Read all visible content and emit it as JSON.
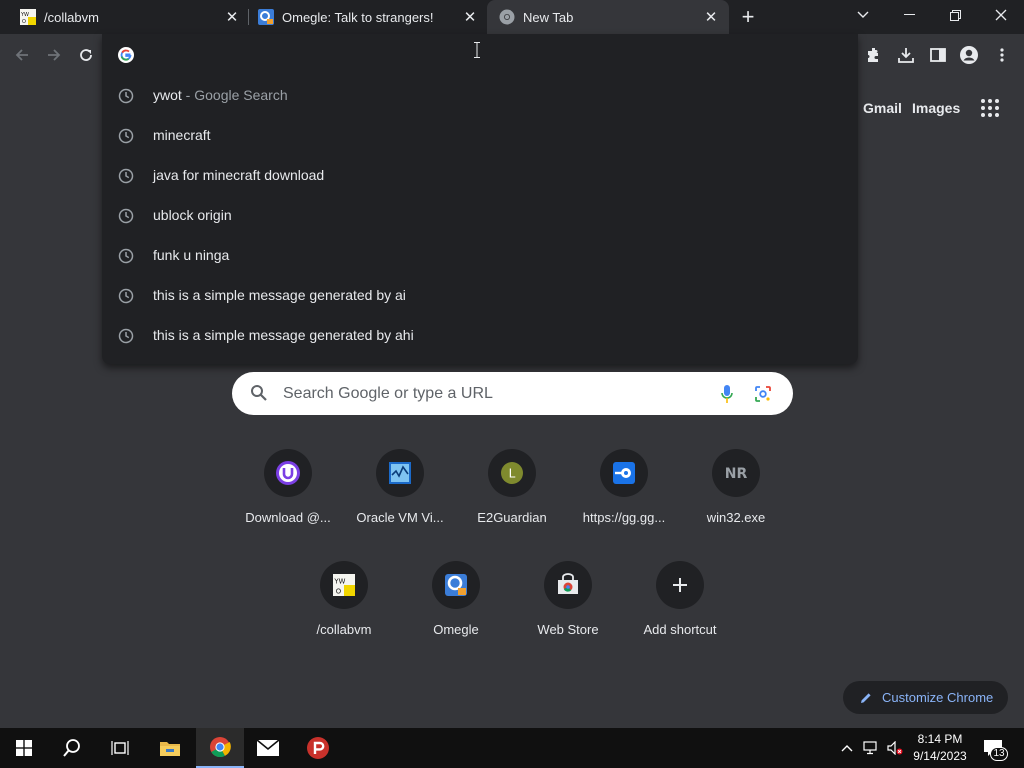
{
  "tabs": [
    {
      "title": "/collabvm",
      "favicon": "ywot-icon"
    },
    {
      "title": "Omegle: Talk to strangers!",
      "favicon": "omegle-icon"
    },
    {
      "title": "New Tab",
      "favicon": "chrome-icon",
      "active": true
    }
  ],
  "omnibox": {
    "value": "",
    "suggestions": [
      {
        "text": "ywot",
        "desc": " - Google Search"
      },
      {
        "text": "minecraft",
        "desc": ""
      },
      {
        "text": "java for minecraft download",
        "desc": ""
      },
      {
        "text": "ublock origin",
        "desc": ""
      },
      {
        "text": "funk u ninga",
        "desc": ""
      },
      {
        "text": "this is a simple message generated by ai",
        "desc": ""
      },
      {
        "text": "this is a simple message generated by ahi",
        "desc": ""
      }
    ]
  },
  "header_links": {
    "gmail": "Gmail",
    "images": "Images"
  },
  "search": {
    "placeholder": "Search Google or type a URL"
  },
  "shortcuts": [
    {
      "label": "Download @...",
      "icon": "U"
    },
    {
      "label": "Oracle VM Vi...",
      "icon": "virtualbox-icon"
    },
    {
      "label": "E2Guardian",
      "icon": "L"
    },
    {
      "label": "https://gg.gg...",
      "icon": "gg-icon"
    },
    {
      "label": "win32.exe",
      "icon": "NR"
    },
    {
      "label": "/collabvm",
      "icon": "ywot-icon"
    },
    {
      "label": "Omegle",
      "icon": "omegle-icon"
    },
    {
      "label": "Web Store",
      "icon": "webstore-icon"
    },
    {
      "label": "Add shortcut",
      "icon": "+"
    }
  ],
  "customize": {
    "label": "Customize Chrome"
  },
  "taskbar": {
    "time": "8:14 PM",
    "date": "9/14/2023",
    "notifications": "13"
  },
  "colors": {
    "accent": "#8ab4f8",
    "background": "#35363a",
    "surface": "#202124"
  }
}
